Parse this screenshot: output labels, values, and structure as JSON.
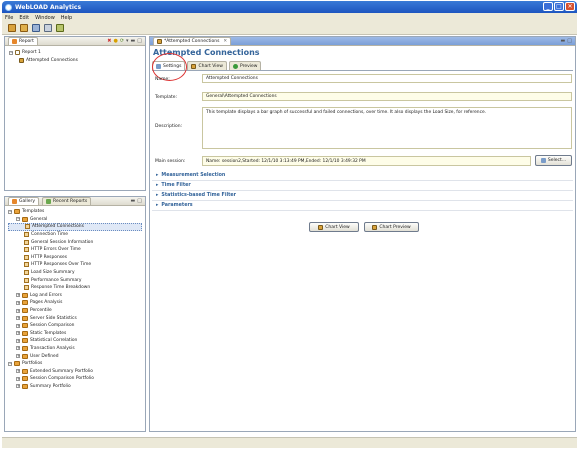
{
  "window": {
    "title": "WebLOAD Analytics"
  },
  "menu": [
    "File",
    "Edit",
    "Window",
    "Help"
  ],
  "report_panel": {
    "tab": "Report",
    "tree": [
      {
        "label": "Report 1",
        "level": 0
      },
      {
        "label": "Attempted Connections",
        "level": 1
      }
    ]
  },
  "gallery_panel": {
    "tabs": [
      "Gallery",
      "Recent Reports"
    ],
    "tree": [
      {
        "label": "Templates",
        "level": 0,
        "type": "folder"
      },
      {
        "label": "General",
        "level": 1,
        "type": "folder"
      },
      {
        "label": "Attempted Connections",
        "level": 2,
        "type": "tmpl",
        "selected": true
      },
      {
        "label": "Connection Time",
        "level": 2,
        "type": "tmpl"
      },
      {
        "label": "General Session Information",
        "level": 2,
        "type": "tmpl"
      },
      {
        "label": "HTTP Errors Over Time",
        "level": 2,
        "type": "tmpl"
      },
      {
        "label": "HTTP Responses",
        "level": 2,
        "type": "tmpl"
      },
      {
        "label": "HTTP Responses Over Time",
        "level": 2,
        "type": "tmpl"
      },
      {
        "label": "Load Size Summary",
        "level": 2,
        "type": "tmpl"
      },
      {
        "label": "Performance Summary",
        "level": 2,
        "type": "tmpl"
      },
      {
        "label": "Response Time Breakdown",
        "level": 2,
        "type": "tmpl"
      },
      {
        "label": "Log and Errors",
        "level": 1,
        "type": "folder"
      },
      {
        "label": "Pages Analysis",
        "level": 1,
        "type": "folder"
      },
      {
        "label": "Percentile",
        "level": 1,
        "type": "folder"
      },
      {
        "label": "Server Side Statistics",
        "level": 1,
        "type": "folder"
      },
      {
        "label": "Session Comparison",
        "level": 1,
        "type": "folder"
      },
      {
        "label": "Static Templates",
        "level": 1,
        "type": "folder"
      },
      {
        "label": "Statistical Correlation",
        "level": 1,
        "type": "folder"
      },
      {
        "label": "Transaction Analysis",
        "level": 1,
        "type": "folder"
      },
      {
        "label": "User Defined",
        "level": 1,
        "type": "folder"
      },
      {
        "label": "Portfolios",
        "level": 0,
        "type": "folder"
      },
      {
        "label": "Extended Summary Portfolio",
        "level": 1,
        "type": "folder"
      },
      {
        "label": "Session Comparison Portfolio",
        "level": 1,
        "type": "folder"
      },
      {
        "label": "Summary Portfolio",
        "level": 1,
        "type": "folder"
      }
    ]
  },
  "editor": {
    "tab": "*Attempted Connections",
    "heading": "Attempted Connections",
    "subtabs": [
      "Settings",
      "Chart View",
      "Preview"
    ],
    "name_label": "Name:",
    "name_value": "Attempted Connections",
    "template_label": "Template:",
    "template_value": "General\\Attempted Connections",
    "description_label": "Description:",
    "description_value": "This template displays a bar graph of successful and failed connections, over time. It also displays the Load Size, for reference.",
    "main_session_label": "Main session:",
    "main_session_value": "Name: session2,Started: 12/1/10 3:13:49 PM,Ended: 12/1/10 3:49:32 PM",
    "select_button": "Select...",
    "sections": [
      "Measurement Selection",
      "Time Filter",
      "Statistics-based Time Filter",
      "Parameters"
    ],
    "buttons": [
      "Chart View",
      "Chart Preview"
    ]
  }
}
